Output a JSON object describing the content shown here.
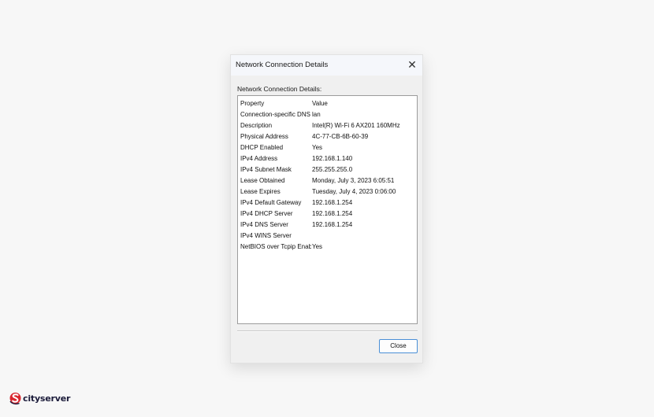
{
  "window": {
    "title": "Network Connection Details",
    "close_glyph": "✕"
  },
  "section_label": "Network Connection Details:",
  "table": {
    "columns": [
      "Property",
      "Value"
    ],
    "rows": [
      {
        "property": "Connection-specific DNS ...",
        "value": "lan"
      },
      {
        "property": "Description",
        "value": "Intel(R) Wi-Fi 6 AX201 160MHz"
      },
      {
        "property": "Physical Address",
        "value": "4C-77-CB-6B-60-39"
      },
      {
        "property": "DHCP Enabled",
        "value": "Yes"
      },
      {
        "property": "IPv4 Address",
        "value": "192.168.1.140"
      },
      {
        "property": "IPv4 Subnet Mask",
        "value": "255.255.255.0"
      },
      {
        "property": "Lease Obtained",
        "value": "Monday, July 3, 2023 6:05:51"
      },
      {
        "property": "Lease Expires",
        "value": "Tuesday, July 4, 2023 0:06:00"
      },
      {
        "property": "IPv4 Default Gateway",
        "value": "192.168.1.254"
      },
      {
        "property": "IPv4 DHCP Server",
        "value": "192.168.1.254"
      },
      {
        "property": "IPv4 DNS Server",
        "value": "192.168.1.254"
      },
      {
        "property": "IPv4 WINS Server",
        "value": ""
      },
      {
        "property": "NetBIOS over Tcpip Enab...",
        "value": "Yes"
      }
    ]
  },
  "buttons": {
    "close_label": "Close"
  },
  "watermark": {
    "text": "cityserver",
    "icon": "cityserver-logo-icon"
  },
  "colors": {
    "button_border_accent": "#4a8fd6",
    "logo_red": "#d9262e",
    "logo_navy": "#1b1b3a"
  }
}
